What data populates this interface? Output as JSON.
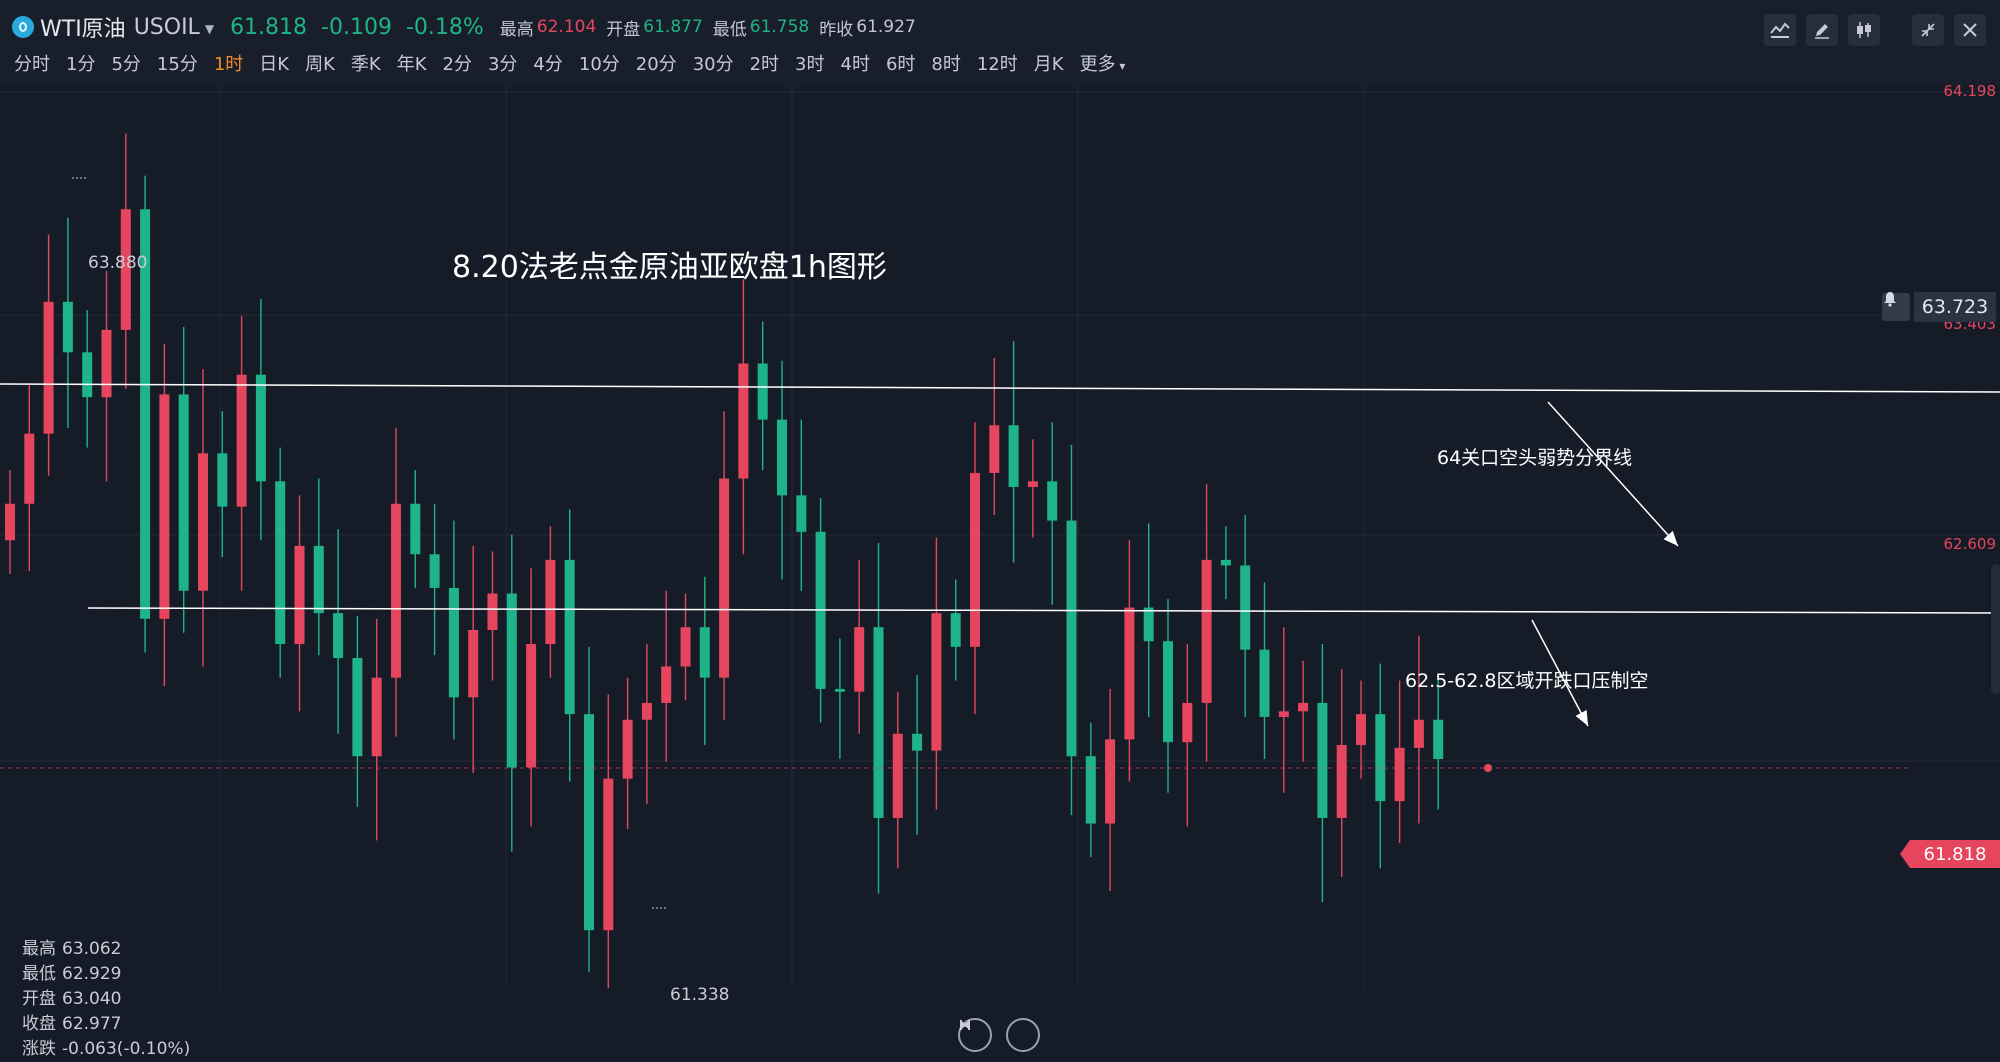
{
  "header": {
    "name": "WTI原油",
    "code": "USOIL",
    "price": "61.818",
    "change": "-0.109",
    "change_pct": "-0.18%",
    "stats": [
      {
        "label": "最高",
        "value": "62.104",
        "color": "red"
      },
      {
        "label": "开盘",
        "value": "61.877",
        "color": "green"
      },
      {
        "label": "最低",
        "value": "61.758",
        "color": "green"
      },
      {
        "label": "昨收",
        "value": "61.927",
        "color": "grey"
      }
    ]
  },
  "toolbar": [
    "indicator-icon",
    "draw-pencil-icon",
    "candles-icon",
    "shrink-icon",
    "close-icon"
  ],
  "intervals": [
    {
      "label": "分时"
    },
    {
      "label": "1分"
    },
    {
      "label": "5分"
    },
    {
      "label": "15分"
    },
    {
      "label": "1时",
      "active": true
    },
    {
      "label": "日K"
    },
    {
      "label": "周K"
    },
    {
      "label": "季K"
    },
    {
      "label": "年K"
    },
    {
      "label": "2分"
    },
    {
      "label": "3分"
    },
    {
      "label": "4分"
    },
    {
      "label": "10分"
    },
    {
      "label": "20分"
    },
    {
      "label": "30分"
    },
    {
      "label": "2时"
    },
    {
      "label": "3时"
    },
    {
      "label": "4时"
    },
    {
      "label": "6时"
    },
    {
      "label": "8时"
    },
    {
      "label": "12时"
    },
    {
      "label": "月K"
    },
    {
      "label": "更多",
      "more": true
    }
  ],
  "chart": {
    "title_note": "8.20法老点金原油亚欧盘1h图形",
    "annotations": [
      "64关口空头弱势分界线",
      "62.5-62.8区域开跌口压制空"
    ],
    "price_axis": [
      "64.198",
      "63.403",
      "62.609"
    ],
    "high_label": "63.880",
    "low_label": "61.338",
    "alert_price": "63.723",
    "current_price": "61.818",
    "info": {
      "high": {
        "label": "最高",
        "value": "63.062"
      },
      "low": {
        "label": "最低",
        "value": "62.929"
      },
      "open": {
        "label": "开盘",
        "value": "63.040"
      },
      "close": {
        "label": "收盘",
        "value": "62.977"
      },
      "change": {
        "label": "涨跌",
        "value": "-0.063(-0.10%)"
      }
    },
    "colors": {
      "up": "#e5465e",
      "down": "#1fb38a",
      "background": "#161c27"
    }
  },
  "chart_data": {
    "type": "candlestick",
    "interval": "1时",
    "closes": [
      62.73,
      62.98,
      63.45,
      63.27,
      63.11,
      63.35,
      63.78,
      62.32,
      63.12,
      62.42,
      62.91,
      62.72,
      63.19,
      62.81,
      62.23,
      62.58,
      62.34,
      62.18,
      61.83,
      62.11,
      62.73,
      62.55,
      62.43,
      62.04,
      62.28,
      62.41,
      61.79,
      62.23,
      62.53,
      61.98,
      61.21,
      61.75,
      61.96,
      62.02,
      62.15,
      62.29,
      62.11,
      62.82,
      63.23,
      63.03,
      62.76,
      62.63,
      62.07,
      62.06,
      62.29,
      61.61,
      61.91,
      61.85,
      62.34,
      62.22,
      62.84,
      63.01,
      62.79,
      62.81,
      62.67,
      61.83,
      61.59,
      61.89,
      62.36,
      62.24,
      61.88,
      62.02,
      62.53,
      62.51,
      62.21,
      61.97,
      61.99,
      62.02,
      61.61,
      61.87,
      61.98,
      61.67,
      61.86,
      61.96,
      61.82
    ]
  }
}
